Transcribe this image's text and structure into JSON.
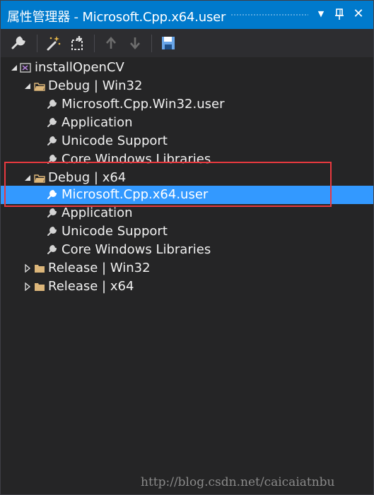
{
  "window": {
    "title": "属性管理器 - Microsoft.Cpp.x64.user"
  },
  "toolbar": {
    "buttons": [
      "properties-wrench-icon",
      "add-new-property-sheet-icon",
      "add-existing-property-sheet-icon",
      "move-up-icon",
      "move-down-icon",
      "save-icon"
    ]
  },
  "tree": {
    "root": "installOpenCV",
    "nodes": [
      {
        "label": "Debug | Win32",
        "expanded": true,
        "children": [
          "Microsoft.Cpp.Win32.user",
          "Application",
          "Unicode Support",
          "Core Windows Libraries"
        ]
      },
      {
        "label": "Debug | x64",
        "expanded": true,
        "children": [
          "Microsoft.Cpp.x64.user",
          "Application",
          "Unicode Support",
          "Core Windows Libraries"
        ],
        "selected_child": "Microsoft.Cpp.x64.user"
      },
      {
        "label": "Release | Win32",
        "expanded": false
      },
      {
        "label": "Release | x64",
        "expanded": false
      }
    ]
  },
  "watermark": "http://blog.csdn.net/caicaiatnbu",
  "colors": {
    "accent": "#007acc",
    "selection": "#3399ff",
    "highlight_box": "#e8393f",
    "background": "#252526"
  }
}
